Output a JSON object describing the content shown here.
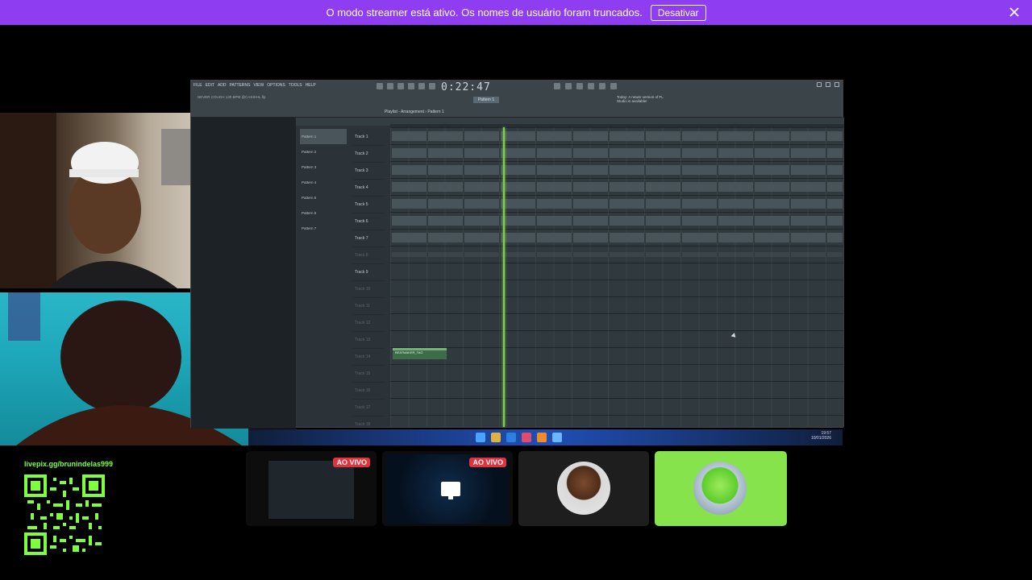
{
  "banner": {
    "message": "O modo streamer está ativo. Os nomes de usuário foram truncados.",
    "button": "Desativar"
  },
  "fl": {
    "menu": [
      "FILE",
      "EDIT",
      "ADD",
      "PATTERNS",
      "VIEW",
      "OPTIONS",
      "TOOLS",
      "HELP"
    ],
    "time": "0:22:47",
    "song": "NEVER COUGH 130 BPM @CASSIHL.flp",
    "pattern_selector": "Pattern 1",
    "playlist_title": "Playlist - Arrangement › Pattern 1",
    "hint": "Today: A newer version of FL Studio is available!",
    "patterns": [
      "Pattern 1",
      "Pattern 2",
      "Pattern 3",
      "Pattern 4",
      "Pattern 5",
      "Pattern 6",
      "Pattern 7"
    ],
    "tracks": [
      "Track 1",
      "Track 2",
      "Track 3",
      "Track 4",
      "Track 5",
      "Track 6",
      "Track 7",
      "Track 8",
      "Track 9",
      "Track 10",
      "Track 11",
      "Track 12",
      "Track 13",
      "Track 14",
      "Track 15",
      "Track 16",
      "Track 17",
      "Track 18"
    ],
    "clip9_label": "BEATMAKER_TAG"
  },
  "taskbar": {
    "clock_time": "19:57",
    "clock_date": "10/01/2026"
  },
  "livepix": "livepix.gg/brunindelas999",
  "tiles": {
    "badge1": "AO VIVO",
    "badge2": "AO VIVO"
  },
  "colors": {
    "banner": "#8e3ef0",
    "live_green": "#7dff3a",
    "live_badge": "#e3323c",
    "playhead": "#7cd148"
  }
}
